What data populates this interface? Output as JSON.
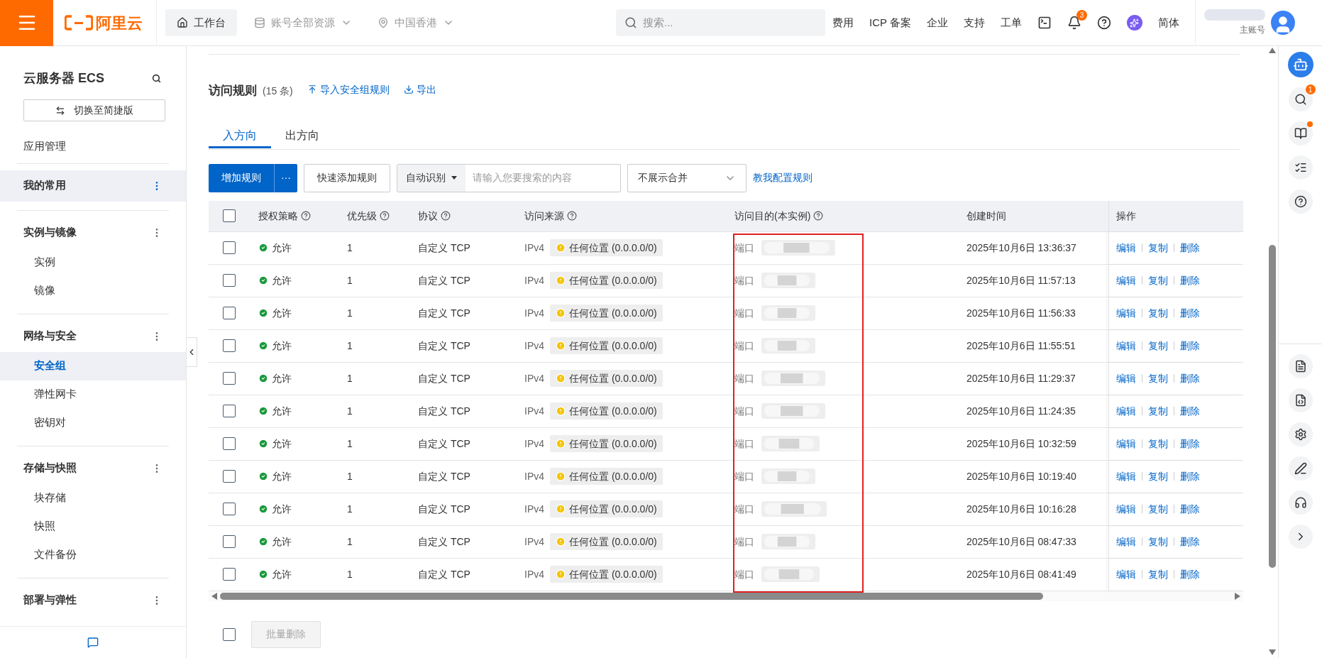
{
  "topbar": {
    "logo": "阿里云",
    "workbench": "工作台",
    "resource_scope": "账号全部资源",
    "region": "中国香港",
    "search": {
      "placeholder": "搜索..."
    },
    "links": [
      "费用",
      "ICP 备案",
      "企业",
      "支持",
      "工单"
    ],
    "notification_count": "3",
    "language": "简体",
    "account_role": "主账号"
  },
  "sidebar": {
    "title": "云服务器 ECS",
    "switch_button": "切换至简捷版",
    "top_item": "应用管理",
    "groups": [
      {
        "label": "我的常用",
        "selected": true
      },
      {
        "label": "实例与镜像",
        "selected": false,
        "items": [
          {
            "label": "实例",
            "selected": false
          },
          {
            "label": "镜像",
            "selected": false
          }
        ]
      },
      {
        "label": "网络与安全",
        "selected": false,
        "items": [
          {
            "label": "安全组",
            "selected": true
          },
          {
            "label": "弹性网卡",
            "selected": false
          },
          {
            "label": "密钥对",
            "selected": false
          }
        ]
      },
      {
        "label": "存储与快照",
        "selected": false,
        "items": [
          {
            "label": "块存储",
            "selected": false
          },
          {
            "label": "快照",
            "selected": false
          },
          {
            "label": "文件备份",
            "selected": false
          }
        ]
      },
      {
        "label": "部署与弹性",
        "selected": false
      }
    ]
  },
  "main": {
    "title": "访问规则",
    "count": "(15 条)",
    "actions": [
      {
        "kind": "import",
        "label": "导入安全组规则"
      },
      {
        "kind": "export",
        "label": "导出"
      }
    ],
    "tabs": [
      {
        "label": "入方向",
        "selected": true
      },
      {
        "label": "出方向",
        "selected": false
      }
    ],
    "toolbar": {
      "add_button": "增加规则",
      "more_button": "···",
      "quick_add_button": "快速添加规则",
      "search_mode": "自动识别",
      "search_placeholder": "请输入您要搜索的内容",
      "merge_select": "不展示合并",
      "help_link": "教我配置规则"
    },
    "table": {
      "select_all_checked": false,
      "columns": [
        {
          "label": "授权策略",
          "help": true
        },
        {
          "label": "优先级",
          "help": true
        },
        {
          "label": "协议",
          "help": true
        },
        {
          "label": "访问来源",
          "help": true
        },
        {
          "label": "访问目的(本实例)",
          "help": true
        },
        {
          "label": "创建时间",
          "help": false
        },
        {
          "label": "操作",
          "help": false
        }
      ],
      "rows": [
        {
          "checked": false,
          "policy": "允许",
          "priority": "1",
          "protocol": "自定义 TCP",
          "ip_version": "IPv4",
          "source": "任何位置 (0.0.0.0/0)",
          "destination": "端口",
          "created": "2025年10月6日 13:36:37",
          "actions": [
            "编辑",
            "复制",
            "删除"
          ]
        },
        {
          "checked": false,
          "policy": "允许",
          "priority": "1",
          "protocol": "自定义 TCP",
          "ip_version": "IPv4",
          "source": "任何位置 (0.0.0.0/0)",
          "destination": "端口",
          "created": "2025年10月6日 11:57:13",
          "actions": [
            "编辑",
            "复制",
            "删除"
          ]
        },
        {
          "checked": false,
          "policy": "允许",
          "priority": "1",
          "protocol": "自定义 TCP",
          "ip_version": "IPv4",
          "source": "任何位置 (0.0.0.0/0)",
          "destination": "端口",
          "created": "2025年10月6日 11:56:33",
          "actions": [
            "编辑",
            "复制",
            "删除"
          ]
        },
        {
          "checked": false,
          "policy": "允许",
          "priority": "1",
          "protocol": "自定义 TCP",
          "ip_version": "IPv4",
          "source": "任何位置 (0.0.0.0/0)",
          "destination": "端口",
          "created": "2025年10月6日 11:55:51",
          "actions": [
            "编辑",
            "复制",
            "删除"
          ]
        },
        {
          "checked": false,
          "policy": "允许",
          "priority": "1",
          "protocol": "自定义 TCP",
          "ip_version": "IPv4",
          "source": "任何位置 (0.0.0.0/0)",
          "destination": "端口",
          "created": "2025年10月6日 11:29:37",
          "actions": [
            "编辑",
            "复制",
            "删除"
          ]
        },
        {
          "checked": false,
          "policy": "允许",
          "priority": "1",
          "protocol": "自定义 TCP",
          "ip_version": "IPv4",
          "source": "任何位置 (0.0.0.0/0)",
          "destination": "端口",
          "created": "2025年10月6日 11:24:35",
          "actions": [
            "编辑",
            "复制",
            "删除"
          ]
        },
        {
          "checked": false,
          "policy": "允许",
          "priority": "1",
          "protocol": "自定义 TCP",
          "ip_version": "IPv4",
          "source": "任何位置 (0.0.0.0/0)",
          "destination": "端口",
          "created": "2025年10月6日 10:32:59",
          "actions": [
            "编辑",
            "复制",
            "删除"
          ]
        },
        {
          "checked": false,
          "policy": "允许",
          "priority": "1",
          "protocol": "自定义 TCP",
          "ip_version": "IPv4",
          "source": "任何位置 (0.0.0.0/0)",
          "destination": "端口",
          "created": "2025年10月6日 10:19:40",
          "actions": [
            "编辑",
            "复制",
            "删除"
          ]
        },
        {
          "checked": false,
          "policy": "允许",
          "priority": "1",
          "protocol": "自定义 TCP",
          "ip_version": "IPv4",
          "source": "任何位置 (0.0.0.0/0)",
          "destination": "端口",
          "created": "2025年10月6日 10:16:28",
          "actions": [
            "编辑",
            "复制",
            "删除"
          ]
        },
        {
          "checked": false,
          "policy": "允许",
          "priority": "1",
          "protocol": "自定义 TCP",
          "ip_version": "IPv4",
          "source": "任何位置 (0.0.0.0/0)",
          "destination": "端口",
          "created": "2025年10月6日 08:47:33",
          "actions": [
            "编辑",
            "复制",
            "删除"
          ]
        },
        {
          "checked": false,
          "policy": "允许",
          "priority": "1",
          "protocol": "自定义 TCP",
          "ip_version": "IPv4",
          "source": "任何位置 (0.0.0.0/0)",
          "destination": "端口",
          "created": "2025年10月6日 08:41:49",
          "actions": [
            "编辑",
            "复制",
            "删除"
          ]
        }
      ]
    },
    "footer": {
      "select_all_checked": false,
      "batch_delete": {
        "label": "批量删除",
        "disabled": true
      }
    }
  },
  "right_rail": {
    "search_badge": "1"
  }
}
